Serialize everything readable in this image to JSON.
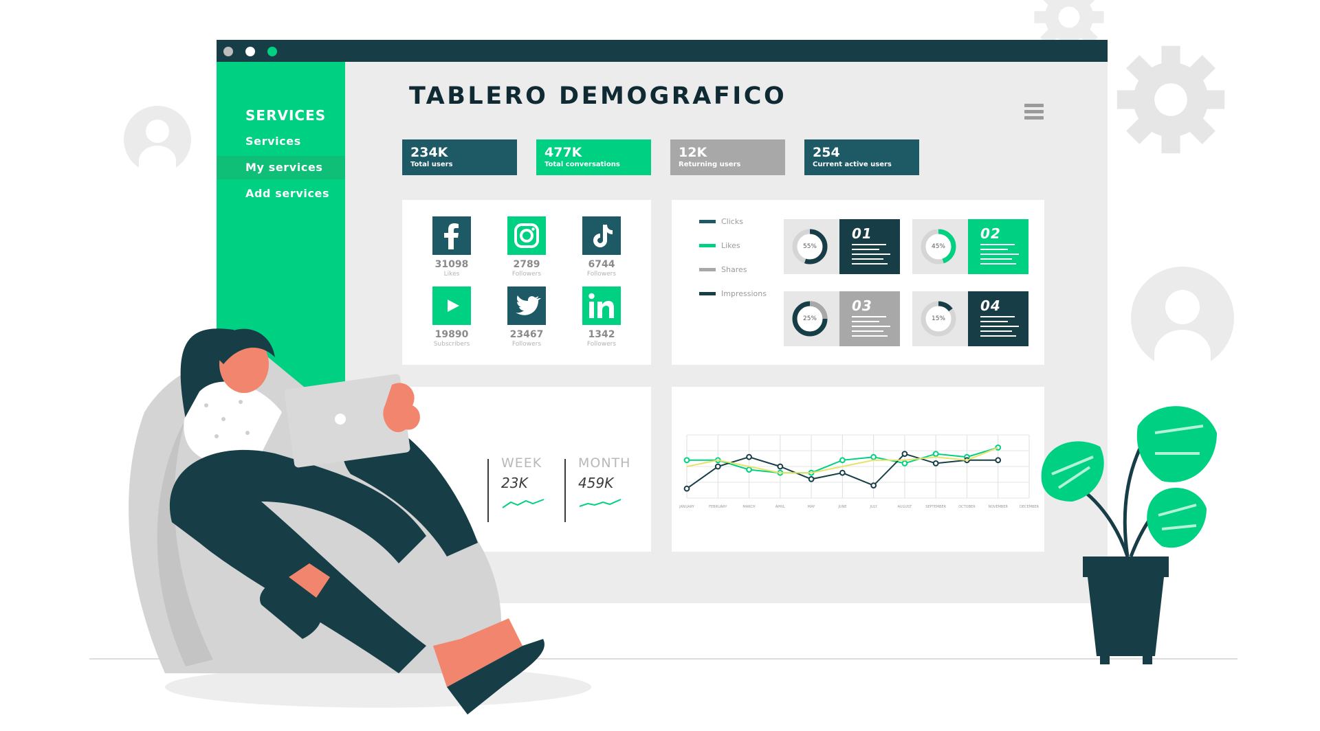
{
  "dashboard": {
    "title": "TABLERO DEMOGRAFICO"
  },
  "sidebar": {
    "title": "SERVICES",
    "items": [
      {
        "label": "Services",
        "active": false
      },
      {
        "label": "My services",
        "active": true
      },
      {
        "label": "Add services",
        "active": false
      }
    ]
  },
  "stats": [
    {
      "value": "234K",
      "label": "Total users",
      "color": "#1e5a66"
    },
    {
      "value": "477K",
      "label": "Total conversations",
      "color": "#00d081"
    },
    {
      "value": "12K",
      "label": "Returning users",
      "color": "#a8a8a8"
    },
    {
      "value": "254",
      "label": "Current active users",
      "color": "#1e5a66"
    }
  ],
  "social": [
    {
      "icon": "facebook-icon",
      "count": "31098",
      "caption": "Likes"
    },
    {
      "icon": "instagram-icon",
      "count": "2789",
      "caption": "Followers"
    },
    {
      "icon": "tiktok-icon",
      "count": "6744",
      "caption": "Followers"
    },
    {
      "icon": "youtube-icon",
      "count": "19890",
      "caption": "Subscribers"
    },
    {
      "icon": "twitter-icon",
      "count": "23467",
      "caption": "Followers"
    },
    {
      "icon": "linkedin-icon",
      "count": "1342",
      "caption": "Followers"
    }
  ],
  "legend": [
    {
      "label": "Clicks",
      "color": "#1e5a66"
    },
    {
      "label": "Likes",
      "color": "#00d081"
    },
    {
      "label": "Shares",
      "color": "#a8a8a8"
    },
    {
      "label": "Impressions",
      "color": "#173d47"
    }
  ],
  "kpis": [
    {
      "number": "01",
      "percent": "55%",
      "fraction": 0.55,
      "color": "#173d47"
    },
    {
      "number": "02",
      "percent": "45%",
      "fraction": 0.45,
      "color": "#00d081"
    },
    {
      "number": "03",
      "percent": "25%",
      "fraction": 0.25,
      "color": "#a8a8a8"
    },
    {
      "number": "04",
      "percent": "15%",
      "fraction": 0.15,
      "color": "#173d47"
    }
  ],
  "periods": [
    {
      "label": "WEEK",
      "value": "23K"
    },
    {
      "label": "MONTH",
      "value": "459K"
    }
  ],
  "chart_data": {
    "type": "line",
    "categories": [
      "JANUARY",
      "FEBRUARY",
      "MARCH",
      "APRIL",
      "MAY",
      "JUNE",
      "JULY",
      "AUGUST",
      "SEPTEMBER",
      "OCTOBER",
      "NOVEMBER",
      "DECEMBER"
    ],
    "series": [
      {
        "values": [
          6,
          6,
          4.5,
          4,
          4,
          6,
          6.5,
          5.5,
          7,
          6.5,
          8
        ]
      },
      {
        "values": [
          1.5,
          5,
          6.5,
          5,
          3,
          4,
          2,
          7,
          5.5,
          6,
          6
        ]
      },
      {
        "values": [
          5,
          6,
          5,
          4,
          4,
          5,
          6,
          6,
          6.5,
          6,
          8
        ]
      }
    ],
    "series_colors": [
      "#00d081",
      "#173d47",
      "#e8e26a"
    ],
    "ylim": [
      0,
      10
    ],
    "grid": true,
    "legend": "none"
  },
  "colors": {
    "accent": "#00d081",
    "dark": "#173d47",
    "gray": "#a8a8a8"
  }
}
